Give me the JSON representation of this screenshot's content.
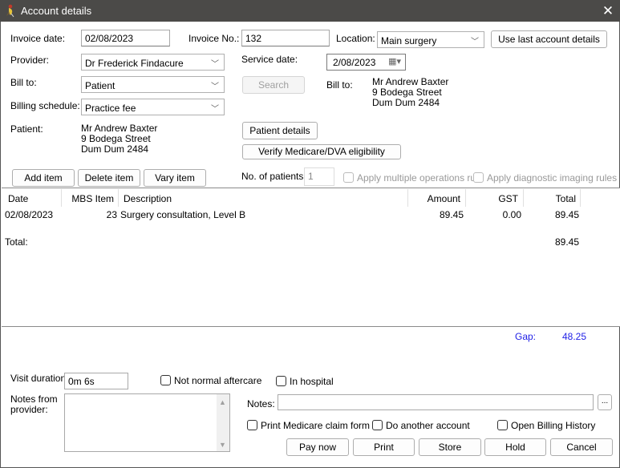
{
  "window": {
    "title": "Account details",
    "close_icon": "close-icon"
  },
  "header": {
    "invoice_date_label": "Invoice date:",
    "invoice_date_value": "02/08/2023",
    "invoice_no_label": "Invoice No.:",
    "invoice_no_value": "132",
    "location_label": "Location:",
    "location_value": "Main surgery",
    "use_last_button": "Use last account details",
    "provider_label": "Provider:",
    "provider_value": "Dr Frederick Findacure",
    "service_date_label": "Service date:",
    "service_date_value": "2/08/2023",
    "bill_to_label": "Bill to:",
    "bill_to_value": "Patient",
    "search_button": "Search",
    "billing_schedule_label": "Billing schedule:",
    "billing_schedule_value": "Practice fee",
    "bill_to_address_label": "Bill to:",
    "bill_to_address": [
      "Mr Andrew Baxter",
      "9 Bodega Street",
      "Dum Dum 2484"
    ],
    "patient_label": "Patient:",
    "patient_address": [
      "Mr Andrew Baxter",
      "9 Bodega Street",
      "Dum Dum  2484"
    ],
    "patient_details_button": "Patient details",
    "verify_button": "Verify Medicare/DVA eligibility"
  },
  "items_toolbar": {
    "add_item": "Add item",
    "delete_item": "Delete item",
    "vary_item": "Vary item",
    "no_patients_label": "No. of patients:",
    "no_patients_value": "1",
    "apply_multiple_ops": "Apply multiple operations rule",
    "apply_diag_imaging": "Apply diagnostic imaging rules"
  },
  "grid": {
    "columns": [
      "Date",
      "MBS Item",
      "Description",
      "Amount",
      "GST",
      "Total"
    ],
    "rows": [
      {
        "date": "02/08/2023",
        "mbs_item": "23",
        "description": "Surgery consultation, Level B",
        "amount": "89.45",
        "gst": "0.00",
        "total": "89.45"
      }
    ],
    "total_label": "Total:",
    "total_value": "89.45"
  },
  "gap": {
    "label": "Gap:",
    "value": "48.25",
    "color": "#1e1ee6"
  },
  "footer": {
    "visit_duration_label": "Visit duration:",
    "visit_duration_value": "0m  6s",
    "not_normal_aftercare": "Not normal aftercare",
    "in_hospital": "In hospital",
    "notes_from_provider_label": [
      "Notes from",
      "provider:"
    ],
    "notes_label": "Notes:",
    "notes_value": "",
    "notes_more_button": "...",
    "print_medicare_claim": "Print Medicare claim form",
    "do_another_account": "Do another account",
    "open_billing_history": "Open Billing History",
    "buttons": [
      "Pay now",
      "Print",
      "Store",
      "Hold",
      "Cancel"
    ]
  }
}
